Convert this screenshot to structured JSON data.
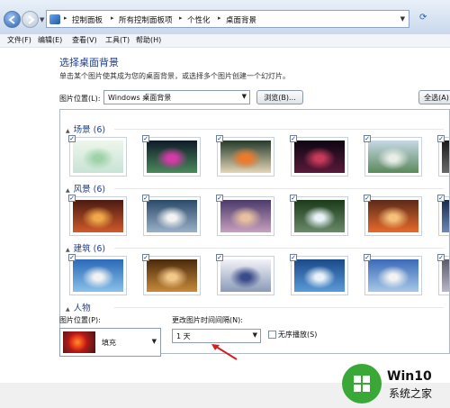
{
  "address_bar": {
    "crumbs": [
      "控制面板",
      "所有控制面板项",
      "个性化",
      "桌面背景"
    ]
  },
  "menu": [
    "文件(F)",
    "编辑(E)",
    "查看(V)",
    "工具(T)",
    "帮助(H)"
  ],
  "page": {
    "title": "选择桌面背景",
    "subtitle": "单击某个图片使其成为您的桌面背景，或选择多个图片创建一个幻灯片。",
    "location_label": "图片位置(L):",
    "location_value": "Windows 桌面背景",
    "browse_label": "浏览(B)...",
    "select_all_label": "全选(A)"
  },
  "groups": [
    {
      "name": "场景 (6)",
      "thumbs": [
        {
          "top": "#eef6ea",
          "bottom": "#c7e3d6",
          "accent": "#9fd2a8"
        },
        {
          "top": "#0e1a2a",
          "bottom": "#4a8a5a",
          "accent": "#d73aa8"
        },
        {
          "top": "#243a2a",
          "bottom": "#e4d6b8",
          "accent": "#ec7a2a"
        },
        {
          "top": "#0c0612",
          "bottom": "#5a1a3a",
          "accent": "#c83a5a"
        },
        {
          "top": "#c6d8e6",
          "bottom": "#5a8a5a",
          "accent": "#e8ede8"
        },
        {
          "top": "#1a1a1a",
          "bottom": "#6a6a6a",
          "accent": "#9a9a9a"
        }
      ]
    },
    {
      "name": "风景 (6)",
      "thumbs": [
        {
          "top": "#4a1a12",
          "bottom": "#d05a2a",
          "accent": "#f0a84a"
        },
        {
          "top": "#2a4a6a",
          "bottom": "#9ab0c8",
          "accent": "#f2f2f2"
        },
        {
          "top": "#4a3a6a",
          "bottom": "#c8a0c0",
          "accent": "#e8c0a0"
        },
        {
          "top": "#1a3a1a",
          "bottom": "#6a8a6a",
          "accent": "#e8f2f8"
        },
        {
          "top": "#5a2a1a",
          "bottom": "#e86a2a",
          "accent": "#f5c07a"
        },
        {
          "top": "#1a2a4a",
          "bottom": "#6a8aba",
          "accent": "#e8e8f2"
        }
      ]
    },
    {
      "name": "建筑 (6)",
      "thumbs": [
        {
          "top": "#2a6ab8",
          "bottom": "#8ac0ea",
          "accent": "#f2f2f2"
        },
        {
          "top": "#4a2a0a",
          "bottom": "#c88a3a",
          "accent": "#f2c88a"
        },
        {
          "top": "#f2f2f8",
          "bottom": "#8a9ab8",
          "accent": "#3a4a8a"
        },
        {
          "top": "#1a4a8a",
          "bottom": "#5a9ad8",
          "accent": "#e8f2fa"
        },
        {
          "top": "#3a6ab8",
          "bottom": "#a8c8e8",
          "accent": "#f2f2f2"
        },
        {
          "top": "#5a5a6a",
          "bottom": "#b8b8c8",
          "accent": "#e0e0e8"
        }
      ]
    },
    {
      "name": "人物",
      "thumbs": []
    }
  ],
  "bottom": {
    "position_label": "图片位置(P):",
    "position_value": "填充",
    "interval_label": "更改图片时间间隔(N):",
    "interval_value": "1 天",
    "shuffle_label": "无序播放(S)"
  },
  "watermark": {
    "brand": "Win10",
    "brand_sub": "系统之家"
  },
  "colors": {
    "title_blue": "#1e3f8c",
    "annotation_red": "#d42020"
  }
}
